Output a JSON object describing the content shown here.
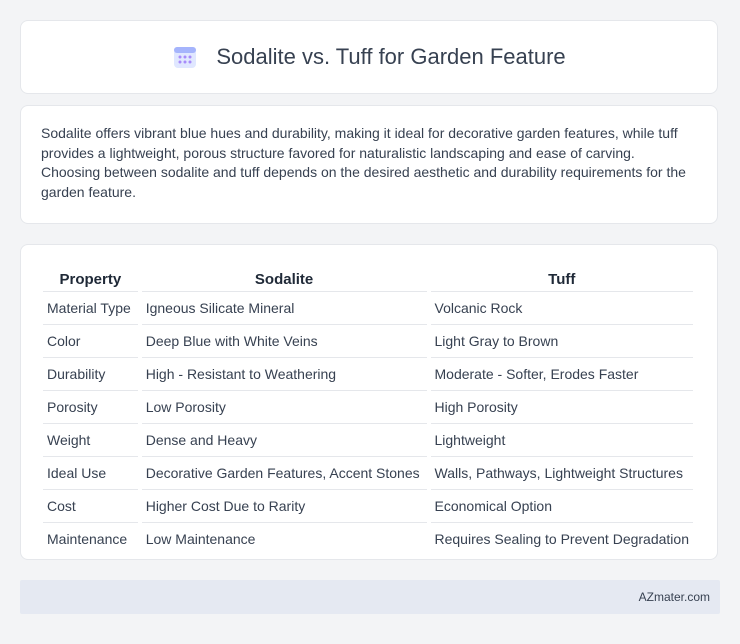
{
  "header": {
    "title": "Sodalite vs. Tuff for Garden Feature",
    "icon": "calendar-icon"
  },
  "summary": {
    "text": "Sodalite offers vibrant blue hues and durability, making it ideal for decorative garden features, while tuff provides a lightweight, porous structure favored for naturalistic landscaping and ease of carving. Choosing between sodalite and tuff depends on the desired aesthetic and durability requirements for the garden feature."
  },
  "table": {
    "headers": [
      "Property",
      "Sodalite",
      "Tuff"
    ],
    "rows": [
      [
        "Material Type",
        "Igneous Silicate Mineral",
        "Volcanic Rock"
      ],
      [
        "Color",
        "Deep Blue with White Veins",
        "Light Gray to Brown"
      ],
      [
        "Durability",
        "High - Resistant to Weathering",
        "Moderate - Softer, Erodes Faster"
      ],
      [
        "Porosity",
        "Low Porosity",
        "High Porosity"
      ],
      [
        "Weight",
        "Dense and Heavy",
        "Lightweight"
      ],
      [
        "Ideal Use",
        "Decorative Garden Features, Accent Stones",
        "Walls, Pathways, Lightweight Structures"
      ],
      [
        "Cost",
        "Higher Cost Due to Rarity",
        "Economical Option"
      ],
      [
        "Maintenance",
        "Low Maintenance",
        "Requires Sealing to Prevent Degradation"
      ]
    ]
  },
  "footer": {
    "brand": "AZmater.com"
  }
}
